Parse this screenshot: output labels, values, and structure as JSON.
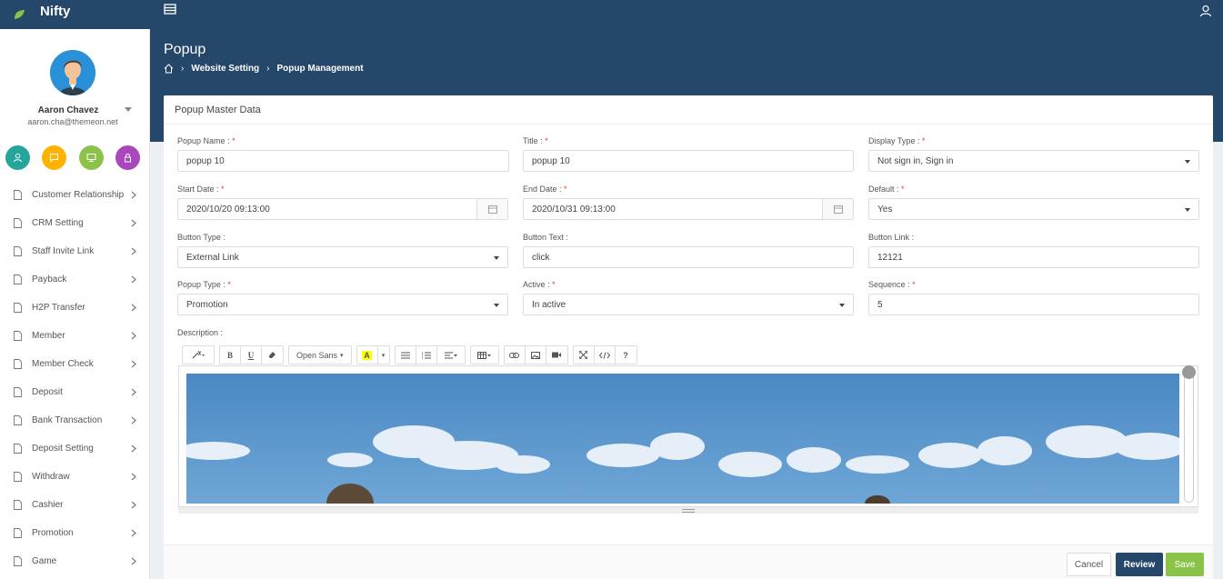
{
  "app": {
    "brand": "Nifty"
  },
  "header": {
    "title": "Popup",
    "breadcrumb": [
      "Website Setting",
      "Popup Management"
    ]
  },
  "user": {
    "name": "Aaron Chavez",
    "email": "aaron.cha@themeon.net"
  },
  "colors": {
    "navy": "#25476a",
    "teal": "#26a69a",
    "amber": "#ffb300",
    "green": "#8bc34a",
    "purple": "#ab47bc"
  },
  "sidebar": {
    "items": [
      {
        "label": "Customer Relationship"
      },
      {
        "label": "CRM Setting"
      },
      {
        "label": "Staff Invite Link"
      },
      {
        "label": "Payback"
      },
      {
        "label": "H2P Transfer"
      },
      {
        "label": "Member"
      },
      {
        "label": "Member Check"
      },
      {
        "label": "Deposit"
      },
      {
        "label": "Bank Transaction"
      },
      {
        "label": "Deposit Setting"
      },
      {
        "label": "Withdraw"
      },
      {
        "label": "Cashier"
      },
      {
        "label": "Promotion"
      },
      {
        "label": "Game"
      }
    ]
  },
  "panel": {
    "title": "Popup Master Data",
    "fields": {
      "popup_name": {
        "label": "Popup Name :",
        "value": "popup 10"
      },
      "title": {
        "label": "Title :",
        "value": "popup 10"
      },
      "display_type": {
        "label": "Display Type :",
        "value": "Not sign in, Sign in"
      },
      "start_date": {
        "label": "Start Date :",
        "value": "2020/10/20 09:13:00"
      },
      "end_date": {
        "label": "End Date :",
        "value": "2020/10/31 09:13:00"
      },
      "default": {
        "label": "Default :",
        "value": "Yes"
      },
      "button_type": {
        "label": "Button Type :",
        "value": "External Link"
      },
      "button_text": {
        "label": "Button Text :",
        "value": "click"
      },
      "button_link": {
        "label": "Button Link :",
        "value": "12121"
      },
      "popup_type": {
        "label": "Popup Type :",
        "value": "Promotion"
      },
      "active": {
        "label": "Active :",
        "value": "In active"
      },
      "sequence": {
        "label": "Sequence :",
        "value": "5"
      }
    },
    "required_mark": "*",
    "description_label": "Description :",
    "toolbar": {
      "font": "Open Sans",
      "bold": "B",
      "underline": "U",
      "help": "?"
    },
    "buttons": {
      "cancel": "Cancel",
      "review": "Review",
      "save": "Save"
    }
  }
}
